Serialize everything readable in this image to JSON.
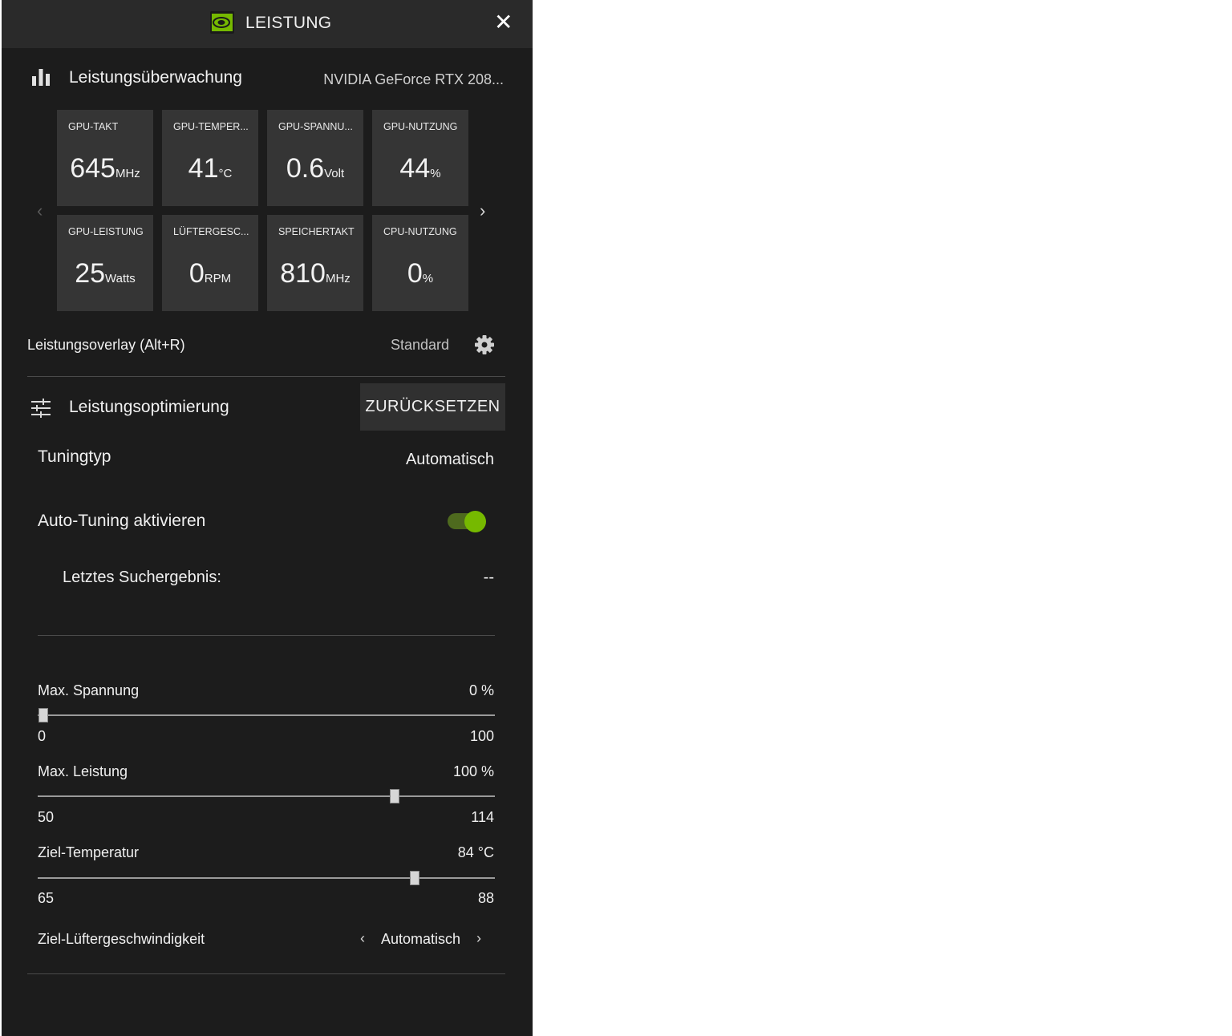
{
  "header": {
    "title": "LEISTUNG",
    "close_glyph": "✕"
  },
  "monitoring": {
    "title": "Leistungsüberwachung",
    "gpu_name": "NVIDIA GeForce RTX 208...",
    "prev_glyph": "‹",
    "next_glyph": "›",
    "tiles": [
      {
        "label": "GPU-TAKT",
        "value": "645",
        "unit": "MHz"
      },
      {
        "label": "GPU-TEMPER...",
        "value": "41",
        "unit": "°C"
      },
      {
        "label": "GPU-SPANNU...",
        "value": "0.6",
        "unit": "Volt"
      },
      {
        "label": "GPU-NUTZUNG",
        "value": "44",
        "unit": "%"
      },
      {
        "label": "GPU-LEISTUNG",
        "value": "25",
        "unit": "Watts"
      },
      {
        "label": "LÜFTERGESC...",
        "value": "0",
        "unit": "RPM"
      },
      {
        "label": "SPEICHERTAKT",
        "value": "810",
        "unit": "MHz"
      },
      {
        "label": "CPU-NUTZUNG",
        "value": "0",
        "unit": "%"
      }
    ]
  },
  "overlay": {
    "label": "Leistungsoverlay (Alt+R)",
    "value": "Standard"
  },
  "optimization": {
    "title": "Leistungsoptimierung",
    "reset_label": "ZURÜCKSETZEN",
    "tuning_type_label": "Tuningtyp",
    "tuning_type_value": "Automatisch",
    "auto_tuning_label": "Auto-Tuning aktivieren",
    "auto_tuning_enabled": true,
    "last_search_label": "Letztes Suchergebnis:",
    "last_search_value": "--"
  },
  "sliders": [
    {
      "label": "Max. Spannung",
      "value_text": "0 %",
      "min": "0",
      "max": "100",
      "fraction": 0.012
    },
    {
      "label": "Max. Leistung",
      "value_text": "100 %",
      "min": "50",
      "max": "114",
      "fraction": 0.78
    },
    {
      "label": "Ziel-Temperatur",
      "value_text": "84 °C",
      "min": "65",
      "max": "88",
      "fraction": 0.825
    }
  ],
  "fan": {
    "label": "Ziel-Lüftergeschwindigkeit",
    "value": "Automatisch",
    "prev_glyph": "‹",
    "next_glyph": "›"
  },
  "colors": {
    "accent": "#76b900",
    "panel": "#1c1c1c",
    "tile": "#353535",
    "titlebar": "#2a2a2a"
  }
}
